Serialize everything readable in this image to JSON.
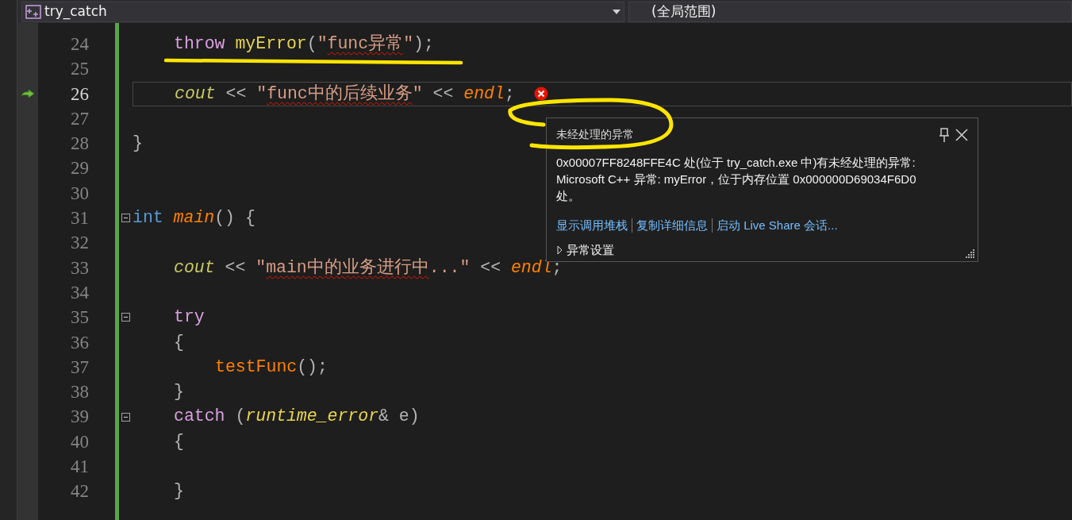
{
  "file_dropdown": {
    "label": "try_catch"
  },
  "scope_dropdown": {
    "label": "(全局范围)"
  },
  "lines": [
    {
      "children": [
        {
          "number": "24",
          "current": false,
          "next_statement": false,
          "error": false,
          "foldable": false,
          "tokens": [
            {
              "kind": "keyword",
              "text": "throw "
            },
            {
              "kind": "class",
              "text": "myError"
            },
            {
              "kind": "plain",
              "text": "("
            },
            {
              "kind": "string",
              "text": "\""
            },
            {
              "kind": "string",
              "text": "func异常",
              "squiggle": true
            },
            {
              "kind": "string",
              "text": "\""
            },
            {
              "kind": "plain",
              "text": ");"
            }
          ]
        },
        {
          "number": "25",
          "current": false,
          "next_statement": false,
          "error": false,
          "foldable": false
        },
        {
          "number": "26",
          "current": true,
          "next_statement": true,
          "error": true,
          "foldable": false,
          "tokens": [
            {
              "kind": "global",
              "text": "cout"
            },
            {
              "kind": "plain",
              "text": " << "
            },
            {
              "kind": "string",
              "text": "\""
            },
            {
              "kind": "string",
              "text": "func中的后续业务",
              "squiggle": true
            },
            {
              "kind": "string",
              "text": "\""
            },
            {
              "kind": "plain",
              "text": " << "
            },
            {
              "kind": "function-italic",
              "text": "endl"
            },
            {
              "kind": "plain",
              "text": ";"
            }
          ]
        },
        {
          "number": "27",
          "current": false,
          "next_statement": false,
          "error": false,
          "foldable": false
        }
      ]
    },
    {
      "number": "28",
      "current": false,
      "next_statement": false,
      "error": false,
      "foldable": false,
      "tokens": [
        {
          "kind": "plain",
          "text": "}"
        }
      ]
    },
    {
      "number": "29",
      "current": false,
      "next_statement": false,
      "error": false,
      "foldable": false
    },
    {
      "number": "30",
      "current": false,
      "next_statement": false,
      "error": false,
      "foldable": false
    },
    {
      "number": "31",
      "current": false,
      "next_statement": false,
      "error": false,
      "foldable": true,
      "tokens": [
        {
          "kind": "type",
          "text": "int "
        },
        {
          "kind": "function-italic",
          "text": "main"
        },
        {
          "kind": "plain",
          "text": "() {"
        }
      ],
      "children": [
        {
          "number": "32",
          "current": false,
          "next_statement": false,
          "error": false,
          "foldable": false
        },
        {
          "number": "33",
          "current": false,
          "next_statement": false,
          "error": false,
          "foldable": false,
          "tokens": [
            {
              "kind": "global",
              "text": "cout"
            },
            {
              "kind": "plain",
              "text": " << "
            },
            {
              "kind": "string",
              "text": "\""
            },
            {
              "kind": "string",
              "text": "main中的业务进行中",
              "squiggle": true
            },
            {
              "kind": "string",
              "text": "...\""
            },
            {
              "kind": "plain",
              "text": " << "
            },
            {
              "kind": "function-italic",
              "text": "endl"
            },
            {
              "kind": "plain",
              "text": ";"
            }
          ]
        },
        {
          "number": "34",
          "current": false,
          "next_statement": false,
          "error": false,
          "foldable": false
        },
        {
          "number": "35",
          "current": false,
          "next_statement": false,
          "error": false,
          "foldable": true,
          "tokens": [
            {
              "kind": "keyword",
              "text": "try"
            }
          ]
        },
        {
          "number": "36",
          "current": false,
          "next_statement": false,
          "error": false,
          "foldable": false,
          "tokens": [
            {
              "kind": "plain",
              "text": "{"
            }
          ],
          "children": [
            {
              "number": "37",
              "current": false,
              "next_statement": false,
              "error": false,
              "foldable": false,
              "tokens": [
                {
                  "kind": "function",
                  "text": "testFunc"
                },
                {
                  "kind": "plain",
                  "text": "();"
                }
              ]
            }
          ]
        },
        {
          "number": "38",
          "current": false,
          "next_statement": false,
          "error": false,
          "foldable": false,
          "tokens": [
            {
              "kind": "plain",
              "text": "}"
            }
          ]
        },
        {
          "number": "39",
          "current": false,
          "next_statement": false,
          "error": false,
          "foldable": true,
          "tokens": [
            {
              "kind": "keyword",
              "text": "catch "
            },
            {
              "kind": "plain",
              "text": "("
            },
            {
              "kind": "type-italic",
              "text": "runtime_error"
            },
            {
              "kind": "plain",
              "text": "& e)"
            }
          ]
        },
        {
          "number": "40",
          "current": false,
          "next_statement": false,
          "error": false,
          "foldable": false,
          "tokens": [
            {
              "kind": "plain",
              "text": "{"
            }
          ],
          "children": [
            {
              "number": "41",
              "current": false,
              "next_statement": false,
              "error": false,
              "foldable": false
            }
          ]
        },
        {
          "number": "42",
          "current": false,
          "next_statement": false,
          "error": false,
          "foldable": false,
          "tokens": [
            {
              "kind": "plain",
              "text": "}"
            }
          ]
        }
      ]
    }
  ],
  "exception_popup": {
    "title": "未经处理的异常",
    "message": "0x00007FF8248FFE4C 处(位于 try_catch.exe 中)有未经处理的异常: Microsoft C++ 异常: myError，位于内存位置 0x000000D69034F6D0 处。",
    "links": [
      "显示调用堆栈",
      "复制详细信息",
      "启动 Live Share 会话..."
    ],
    "settings": {
      "label": "异常设置",
      "expanded": false
    }
  }
}
